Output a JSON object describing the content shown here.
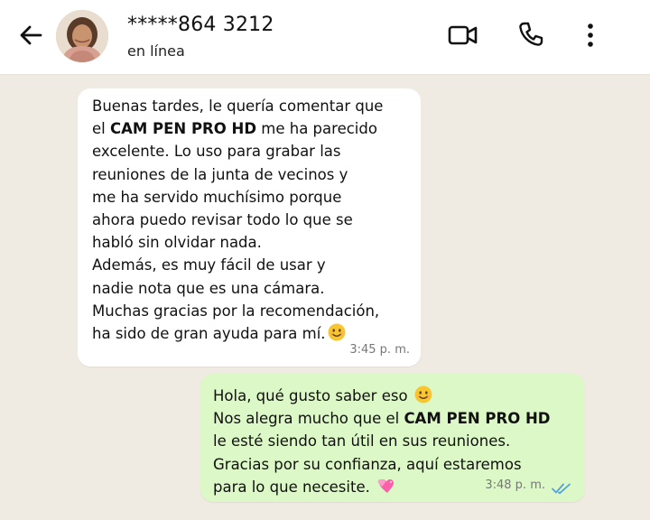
{
  "header": {
    "contact_name": "*****864 3212",
    "status": "en línea"
  },
  "icons": {
    "back": "arrow-left-icon",
    "video": "video-camera-icon",
    "call": "phone-icon",
    "menu": "more-vertical-icon"
  },
  "colors": {
    "chat_background": "#efeae2",
    "incoming_bubble": "#ffffff",
    "outgoing_bubble": "#dcf8c6",
    "read_ticks": "#4fa3e0"
  },
  "messages": {
    "incoming": {
      "line1": "Buenas tardes, le quería comentar que",
      "line2_pre": "el ",
      "line2_bold": "CAM PEN PRO HD",
      "line2_post": " me ha parecido",
      "line3": "excelente. Lo uso para grabar las",
      "line4": "reuniones de la junta de vecinos y",
      "line5": "me ha servido muchísimo porque",
      "line6": "ahora puedo revisar todo lo que se",
      "line7": "habló sin olvidar nada.",
      "line8": "Además, es muy fácil de usar y",
      "line9": "nadie nota que es una cámara.",
      "line10": "Muchas gracias por la recomendación,",
      "line11": "ha sido de gran ayuda para mí.",
      "line11_emoji": "smiling-face-emoji",
      "time": "3:45 p. m."
    },
    "outgoing": {
      "line1": "Hola, qué gusto saber eso",
      "line1_emoji": "smiling-face-emoji",
      "line2_pre": "Nos alegra mucho que el ",
      "line2_bold": "CAM PEN PRO HD",
      "line3": "le esté siendo tan útil en sus reuniones.",
      "line4": "Gracias por su confianza, aquí estaremos",
      "line5": "para lo que necesite.",
      "line5_emoji": "two-hearts-emoji",
      "time": "3:48 p. m.",
      "status_icon": "double-check-read-icon"
    }
  }
}
